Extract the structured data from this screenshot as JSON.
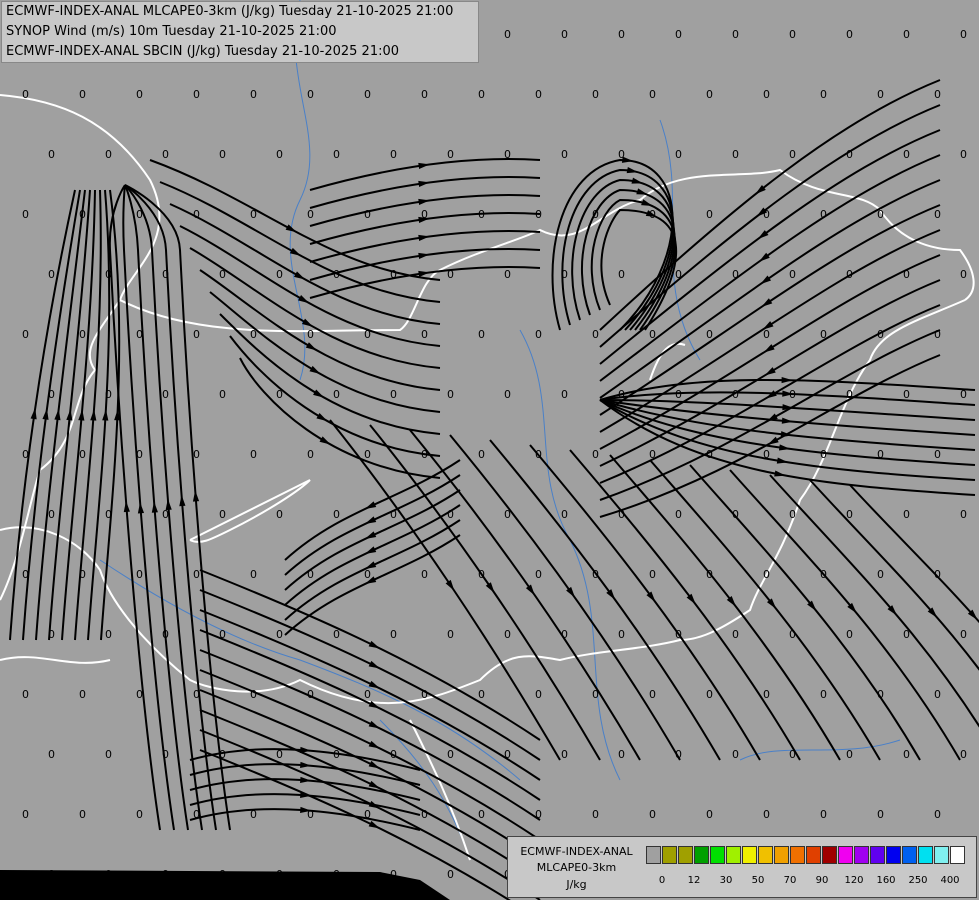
{
  "titles": [
    "ECMWF-INDEX-ANAL MLCAPE0-3km (J/kg) Tuesday 21-10-2025 21:00",
    "SYNOP Wind (m/s) 10m Tuesday 21-10-2025 21:00",
    "ECMWF-INDEX-ANAL SBCIN (J/kg) Tuesday 21-10-2025 21:00"
  ],
  "grid_value": "0",
  "colors": {
    "background": "#a0a0a0",
    "streamlines": "#000000",
    "borders": "#ffffff",
    "rivers": "#4a80c8"
  },
  "legend": {
    "title_lines": [
      "ECMWF-INDEX-ANAL",
      "MLCAPE0-3km",
      "J/kg"
    ],
    "colors": [
      "#a0a0a0",
      "#a0a000",
      "#a0a000",
      "#00a000",
      "#00e000",
      "#a0f000",
      "#f0f000",
      "#f0c000",
      "#f0a000",
      "#f07000",
      "#e04000",
      "#a00000",
      "#f000f0",
      "#a000f0",
      "#6000f0",
      "#0000f0",
      "#0060f0",
      "#00e0f0",
      "#80f0f0",
      "#ffffff"
    ],
    "ticks": [
      "0",
      "12",
      "30",
      "50",
      "70",
      "90",
      "120",
      "160",
      "250",
      "400"
    ]
  }
}
